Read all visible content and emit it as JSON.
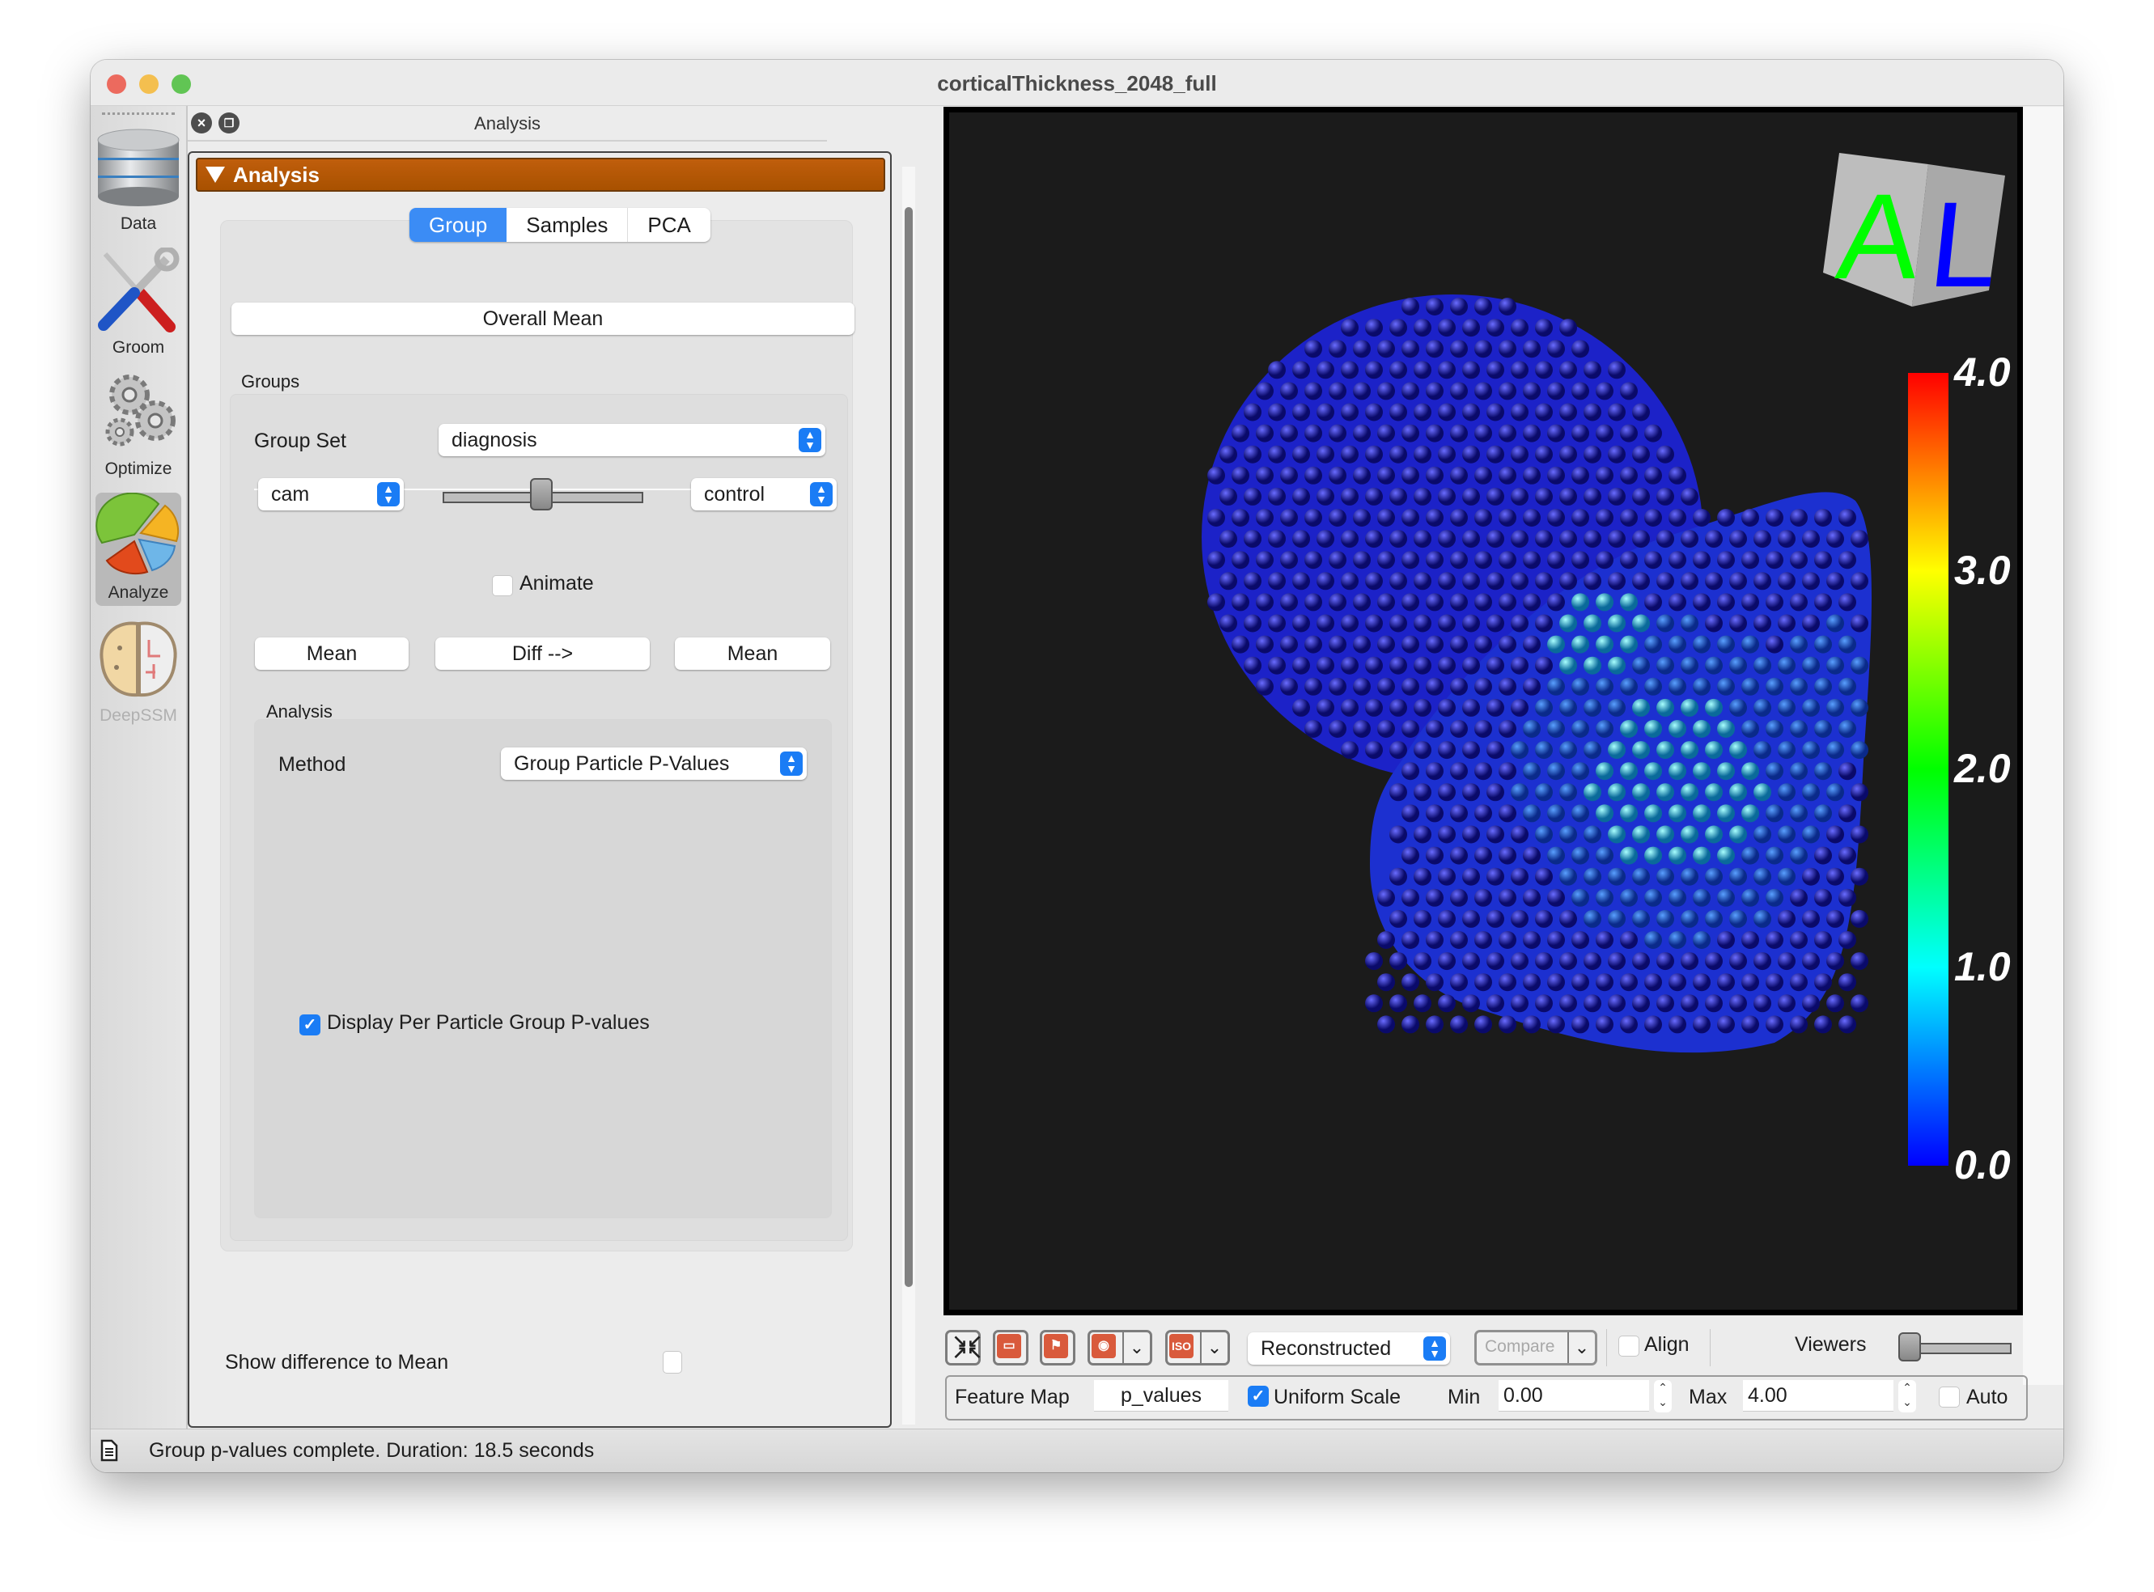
{
  "window": {
    "title": "corticalThickness_2048_full",
    "traffic_lights": {
      "close": "#ec6a5e",
      "minimize": "#f4bf4f",
      "zoom": "#61c554"
    }
  },
  "sidebar": {
    "items": [
      {
        "label": "Data",
        "icon": "database-icon",
        "active": false,
        "enabled": true
      },
      {
        "label": "Groom",
        "icon": "tools-icon",
        "active": false,
        "enabled": true
      },
      {
        "label": "Optimize",
        "icon": "gears-icon",
        "active": false,
        "enabled": true
      },
      {
        "label": "Analyze",
        "icon": "pie-chart-icon",
        "active": true,
        "enabled": true
      },
      {
        "label": "DeepSSM",
        "icon": "brain-icon",
        "active": false,
        "enabled": false
      }
    ]
  },
  "dock": {
    "title": "Analysis",
    "close_icon": "close-icon",
    "float_icon": "float-icon",
    "section_header": "Analysis",
    "accent": "#b35802",
    "tabs": [
      {
        "label": "Group",
        "active": true
      },
      {
        "label": "Samples",
        "active": false
      },
      {
        "label": "PCA",
        "active": false
      }
    ],
    "overall_mean_button": "Overall Mean",
    "groups": {
      "title": "Groups",
      "group_set_label": "Group Set",
      "group_set_value": "diagnosis",
      "left_group": "cam",
      "right_group": "control",
      "slider_value_fraction": 0.5,
      "animate_label": "Animate",
      "animate_checked": false,
      "left_mean_button": "Mean",
      "diff_button": "Diff -->",
      "right_mean_button": "Mean"
    },
    "analysis": {
      "title": "Analysis",
      "method_label": "Method",
      "method_value": "Group Particle P-Values",
      "display_pvalues_label": "Display Per Particle Group P-values",
      "display_pvalues_checked": true
    },
    "show_difference_label": "Show difference to Mean",
    "show_difference_checked": false
  },
  "viewer": {
    "orientation_cube": {
      "left_face": "A",
      "right_face": "L",
      "left_color": "#00ff00",
      "right_color": "#0000ff"
    },
    "colorbar": {
      "min": 0.0,
      "max": 4.0,
      "ticks": [
        "4.0",
        "3.0",
        "2.0",
        "1.0",
        "0.0"
      ],
      "colormap": [
        "#0000ff",
        "#00ffff",
        "#00ff00",
        "#ffff00",
        "#ff0000"
      ]
    },
    "background": "#1b1b1b"
  },
  "view_toolbar": {
    "buttons": [
      {
        "name": "autoview",
        "icon": "collapse-arrows-icon"
      },
      {
        "name": "view-cycle",
        "icon": "monitor-icon"
      },
      {
        "name": "landmarks",
        "icon": "flag-icon"
      },
      {
        "name": "glyph-visibility",
        "icon": "eye-icon",
        "has_dropdown": true
      },
      {
        "name": "isosurface",
        "icon": "iso-icon",
        "iso_text": "ISO",
        "has_dropdown": true
      }
    ],
    "display_mode": "Reconstructed",
    "compare_label": "Compare",
    "align_label": "Align",
    "align_checked": false,
    "viewers_label": "Viewers",
    "viewers_slider_fraction": 0.0
  },
  "feature_map_bar": {
    "feature_map_label": "Feature Map",
    "feature_map_value": "p_values",
    "uniform_scale_label": "Uniform Scale",
    "uniform_scale_checked": true,
    "min_label": "Min",
    "min_value": "0.00",
    "max_label": "Max",
    "max_value": "4.00",
    "auto_label": "Auto",
    "auto_checked": false
  },
  "status_bar": {
    "icon": "log-document-icon",
    "message": "Group p-values complete.  Duration: 18.5 seconds"
  }
}
